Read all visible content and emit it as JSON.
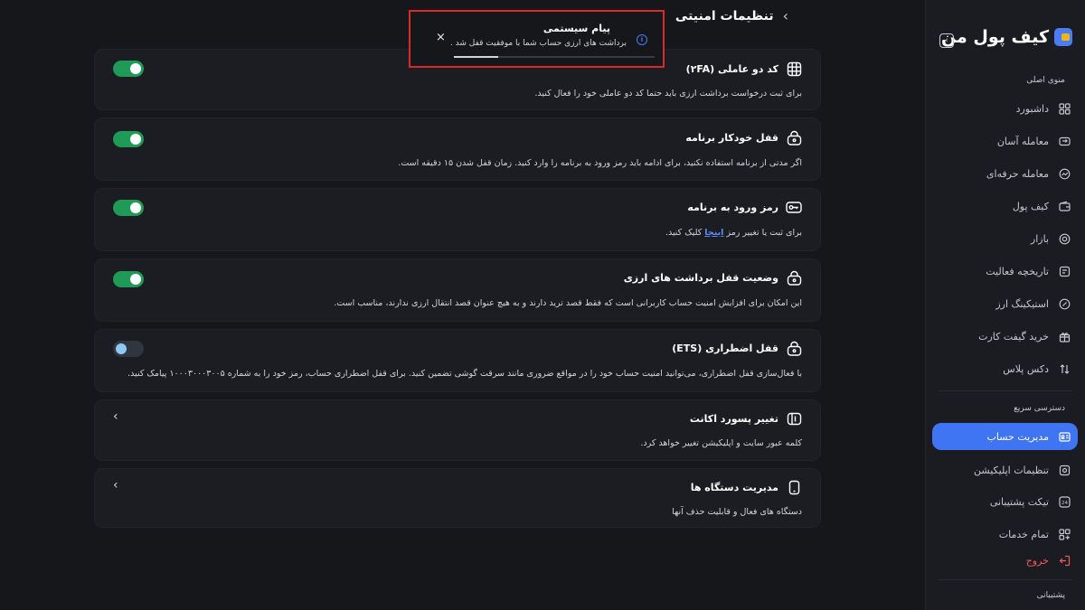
{
  "sidebar": {
    "brand": "کیف پول من",
    "collapse_icon": "chevron-left-icon",
    "section_main": "منوی اصلی",
    "main_items": [
      {
        "label": "داشبورد",
        "icon": "grid-icon"
      },
      {
        "label": "معامله آسان",
        "icon": "swap-icon"
      },
      {
        "label": "معامله حرفه‌ای",
        "icon": "chart-icon"
      },
      {
        "label": "کیف پول",
        "icon": "wallet-icon"
      },
      {
        "label": "بازار",
        "icon": "market-icon"
      },
      {
        "label": "تاریخچه فعالیت",
        "icon": "history-icon"
      },
      {
        "label": "استیکینگ ارز",
        "icon": "staking-icon"
      },
      {
        "label": "خرید گیفت کارت",
        "icon": "gift-icon"
      },
      {
        "label": "دکس پلاس",
        "icon": "dex-icon"
      }
    ],
    "section_quick": "دسترسی سریع",
    "quick_items": [
      {
        "label": "مدیریت حساب",
        "icon": "id-card-icon",
        "active": true
      },
      {
        "label": "تنظیمات اپلیکیشن",
        "icon": "settings-icon"
      },
      {
        "label": "تیکت پشتیبانی",
        "icon": "support-24-icon"
      },
      {
        "label": "تمام خدمات",
        "icon": "apps-icon"
      },
      {
        "label": "خروج",
        "icon": "logout-icon",
        "danger": true
      }
    ],
    "section_support": "پشتیبانی"
  },
  "header": {
    "title": "تنظیمات امنیتی",
    "back_icon": "chevron-right-icon"
  },
  "cards": [
    {
      "title": "کد دو عاملی (۲FA)",
      "desc": "برای ثبت درخواست برداشت ارزی باید حتما کد دو عاملی خود را فعال کنید.",
      "icon": "qr-grid-icon",
      "toggle": true
    },
    {
      "title": "قفل خودکار برنامه",
      "desc": "اگر مدتی از برنامه استفاده نکنید، برای ادامه باید رمز ورود به برنامه را وارد کنید. زمان قفل شدن ۱۵ دقیقه است.",
      "icon": "lock-icon",
      "toggle": true
    },
    {
      "title": "رمز ورود به برنامه",
      "desc_before": "برای ثبت یا تغییر رمز",
      "desc_link": "اینجا",
      "desc_after": "کلیک کنید.",
      "icon": "key-icon",
      "toggle": true
    },
    {
      "title": "وضعیت قفل برداشت های ارزی",
      "desc": "این امکان برای افزایش امنیت حساب کاربرانی است که فقط قصد ترید دارند و به هیچ عنوان قصد انتقال ارزی ندارند، مناسب است.",
      "icon": "lock-icon",
      "toggle": true
    },
    {
      "title": "قفل اضطراری (ETS)",
      "desc": "با فعال‌سازی قفل اضطراری، می‌توانید امنیت حساب خود را در مواقع ضروری مانند سرقت گوشی تضمین کنید.  برای قفل اضطراری حساب، رمز خود را به شماره ۱۰۰۰۳۰۰۰۳۰۰۵ پیامک کنید.",
      "icon": "lock-icon",
      "toggle": false
    },
    {
      "title": "تغییر پسورد اکانت",
      "desc": "کلمه عبور سایت و اپلیکیشن تغییر خواهد کرد.",
      "icon": "password-icon",
      "chevron": "chevron-left-icon"
    },
    {
      "title": "مدیریت دستگاه ها",
      "desc": "دستگاه های فعال و قابلیت حذف آنها",
      "icon": "device-icon",
      "chevron": "chevron-left-icon"
    }
  ],
  "toast": {
    "title": "پیام سیستمی",
    "text": "برداشت های ارزی حساب شما با موفقیت قفل شد .",
    "close": "×",
    "info": "i",
    "progress": 0.22
  },
  "colors": {
    "accent": "#3f75f3",
    "toggle_on": "#1f9a57",
    "danger": "#ef5b5b",
    "toast_border": "#d92a2a"
  }
}
